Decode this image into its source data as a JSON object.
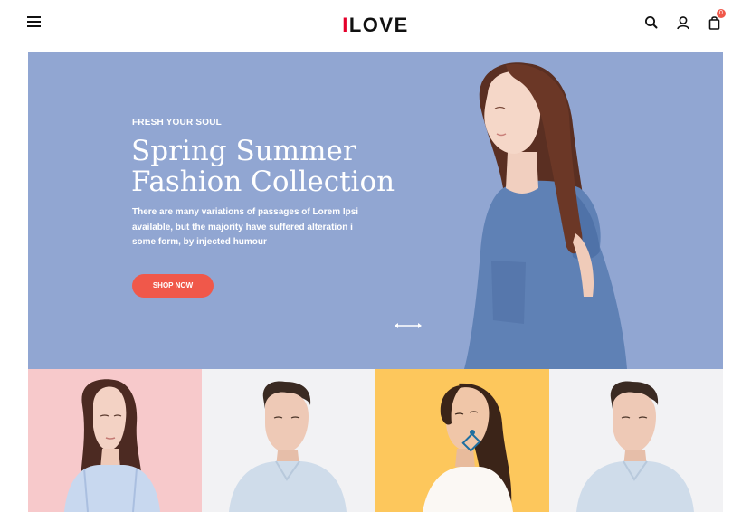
{
  "header": {
    "logo_accent": "I",
    "logo_rest": "LOVE",
    "cart_count": "0",
    "icons": [
      "menu-icon",
      "search-icon",
      "user-icon",
      "shopping-bag-icon"
    ]
  },
  "hero": {
    "kicker": "FRESH YOUR SOUL",
    "title_line1": "Spring Summer",
    "title_line2": "Fashion Collection",
    "desc_line1": "There are many variations of passages of Lorem Ipsi",
    "desc_line2": "available, but the majority have suffered alteration i",
    "desc_line3": "some form, by injected humour",
    "cta_label": "SHOP NOW",
    "background_color": "#91a6d2",
    "cta_color": "#f0584a"
  },
  "products": [
    {
      "background": "#f7c9cb",
      "subject": "woman-sleeveless-blouse"
    },
    {
      "background": "#f2f2f4",
      "subject": "man-light-shirt"
    },
    {
      "background": "#fdc75c",
      "subject": "woman-earring-white-top"
    },
    {
      "background": "#f2f2f4",
      "subject": "man-light-shirt"
    }
  ]
}
